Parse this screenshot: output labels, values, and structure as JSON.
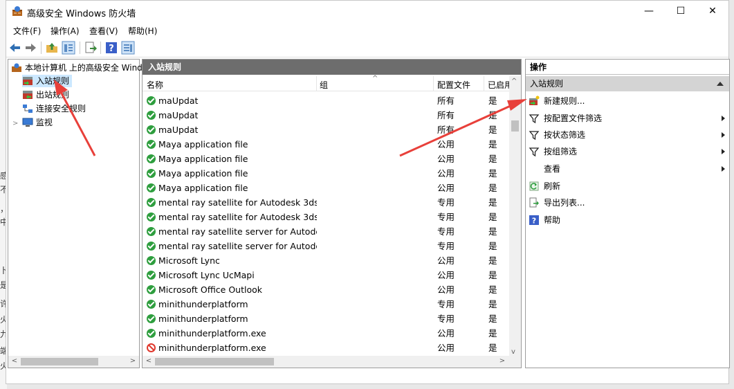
{
  "window": {
    "title": "高级安全 Windows 防火墙",
    "minimize": "—",
    "maximize": "☐",
    "close": "✕"
  },
  "menu": [
    "文件(F)",
    "操作(A)",
    "查看(V)",
    "帮助(H)"
  ],
  "tree": {
    "root": "本地计算机 上的高级安全 Wind",
    "items": [
      "入站规则",
      "出站规则",
      "连接安全规则",
      "监视"
    ]
  },
  "main": {
    "header": "入站规则",
    "columns": [
      "名称",
      "组",
      "配置文件",
      "已启用"
    ],
    "rows": [
      {
        "name": "maUpdat",
        "group": "",
        "profile": "所有",
        "enabled": "是",
        "status": "allow"
      },
      {
        "name": "maUpdat",
        "group": "",
        "profile": "所有",
        "enabled": "是",
        "status": "allow"
      },
      {
        "name": "maUpdat",
        "group": "",
        "profile": "所有",
        "enabled": "是",
        "status": "allow"
      },
      {
        "name": "Maya application file",
        "group": "",
        "profile": "公用",
        "enabled": "是",
        "status": "allow"
      },
      {
        "name": "Maya application file",
        "group": "",
        "profile": "公用",
        "enabled": "是",
        "status": "allow"
      },
      {
        "name": "Maya application file",
        "group": "",
        "profile": "公用",
        "enabled": "是",
        "status": "allow"
      },
      {
        "name": "Maya application file",
        "group": "",
        "profile": "公用",
        "enabled": "是",
        "status": "allow"
      },
      {
        "name": "mental ray satellite for Autodesk 3ds...",
        "group": "",
        "profile": "专用",
        "enabled": "是",
        "status": "allow"
      },
      {
        "name": "mental ray satellite for Autodesk 3ds...",
        "group": "",
        "profile": "专用",
        "enabled": "是",
        "status": "allow"
      },
      {
        "name": "mental ray satellite server for Autode...",
        "group": "",
        "profile": "专用",
        "enabled": "是",
        "status": "allow"
      },
      {
        "name": "mental ray satellite server for Autode...",
        "group": "",
        "profile": "专用",
        "enabled": "是",
        "status": "allow"
      },
      {
        "name": "Microsoft Lync",
        "group": "",
        "profile": "公用",
        "enabled": "是",
        "status": "allow"
      },
      {
        "name": "Microsoft Lync UcMapi",
        "group": "",
        "profile": "公用",
        "enabled": "是",
        "status": "allow"
      },
      {
        "name": "Microsoft Office Outlook",
        "group": "",
        "profile": "公用",
        "enabled": "是",
        "status": "allow"
      },
      {
        "name": "minithunderplatform",
        "group": "",
        "profile": "专用",
        "enabled": "是",
        "status": "allow"
      },
      {
        "name": "minithunderplatform",
        "group": "",
        "profile": "专用",
        "enabled": "是",
        "status": "allow"
      },
      {
        "name": "minithunderplatform.exe",
        "group": "",
        "profile": "公用",
        "enabled": "是",
        "status": "allow"
      },
      {
        "name": "minithunderplatform.exe",
        "group": "",
        "profile": "公用",
        "enabled": "是",
        "status": "block"
      }
    ]
  },
  "actions": {
    "header": "操作",
    "section": "入站规则",
    "items": [
      {
        "label": "新建规则...",
        "icon": "new-rule-icon",
        "submenu": false
      },
      {
        "label": "按配置文件筛选",
        "icon": "filter-icon",
        "submenu": true
      },
      {
        "label": "按状态筛选",
        "icon": "filter-icon",
        "submenu": true
      },
      {
        "label": "按组筛选",
        "icon": "filter-icon",
        "submenu": true
      },
      {
        "label": "查看",
        "icon": "",
        "submenu": true
      },
      {
        "label": "刷新",
        "icon": "refresh-icon",
        "submenu": false
      },
      {
        "label": "导出列表...",
        "icon": "export-icon",
        "submenu": false
      },
      {
        "label": "帮助",
        "icon": "help-icon",
        "submenu": false
      }
    ]
  },
  "background_text": [
    "感",
    "不",
    "，",
    "中",
    "卜",
    "是",
    "许",
    "火",
    "九",
    "端",
    "火"
  ],
  "colors": {
    "accent_arrow": "#e8403a",
    "allow": "#2e9e3e",
    "block": "#e0382d",
    "pane_header": "#6d6d6d"
  }
}
